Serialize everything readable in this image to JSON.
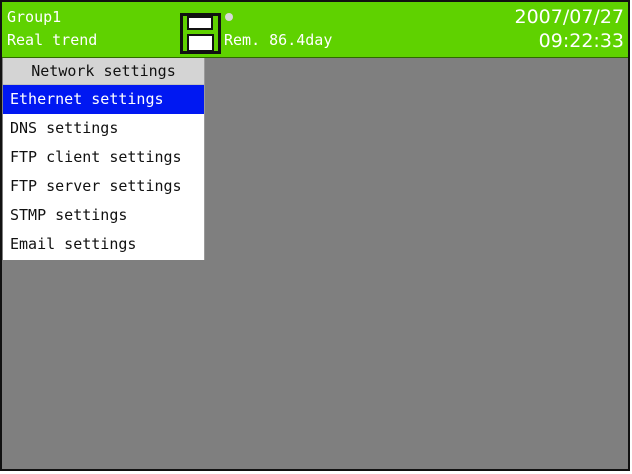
{
  "status": {
    "group": "Group1",
    "mode": "Real trend",
    "remaining": "Rem. 86.4day",
    "date": "2007/07/27",
    "time": "09:22:33",
    "icon": "floppy-disk-icon",
    "indicator": "media-access-indicator"
  },
  "menu": {
    "title": "Network settings",
    "items": [
      {
        "label": "Ethernet settings",
        "selected": true
      },
      {
        "label": "DNS settings",
        "selected": false
      },
      {
        "label": "FTP client settings",
        "selected": false
      },
      {
        "label": "FTP server settings",
        "selected": false
      },
      {
        "label": "STMP settings",
        "selected": false
      },
      {
        "label": "Email settings",
        "selected": false
      }
    ]
  },
  "colors": {
    "status_bar": "#5fd200",
    "selection": "#0018f2",
    "background": "#7f7f7f",
    "menu_title": "#d4d4d4"
  }
}
